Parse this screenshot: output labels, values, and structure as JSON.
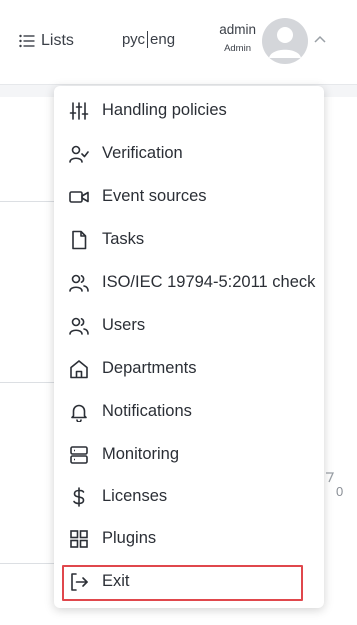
{
  "header": {
    "lists_label": "Lists",
    "lang_ru": "рус",
    "lang_en": "eng",
    "user_name": "admin",
    "user_role": "Admin"
  },
  "menu": {
    "items": [
      {
        "label": "Handling policies",
        "icon": "sliders-icon"
      },
      {
        "label": "Verification",
        "icon": "user-check-icon"
      },
      {
        "label": "Event sources",
        "icon": "video-camera-icon"
      },
      {
        "label": "Tasks",
        "icon": "document-icon"
      },
      {
        "label": "ISO/IEC 19794-5:2011 check",
        "icon": "users-icon"
      },
      {
        "label": "Users",
        "icon": "users-icon"
      },
      {
        "label": "Departments",
        "icon": "home-icon"
      },
      {
        "label": "Notifications",
        "icon": "bell-icon"
      },
      {
        "label": "Monitoring",
        "icon": "server-icon"
      },
      {
        "label": "Licenses",
        "icon": "dollar-icon"
      },
      {
        "label": "Plugins",
        "icon": "grid-icon"
      },
      {
        "label": "Exit",
        "icon": "logout-icon"
      }
    ],
    "highlight_color": "#e0474c"
  },
  "background": {
    "side_value": "0"
  }
}
